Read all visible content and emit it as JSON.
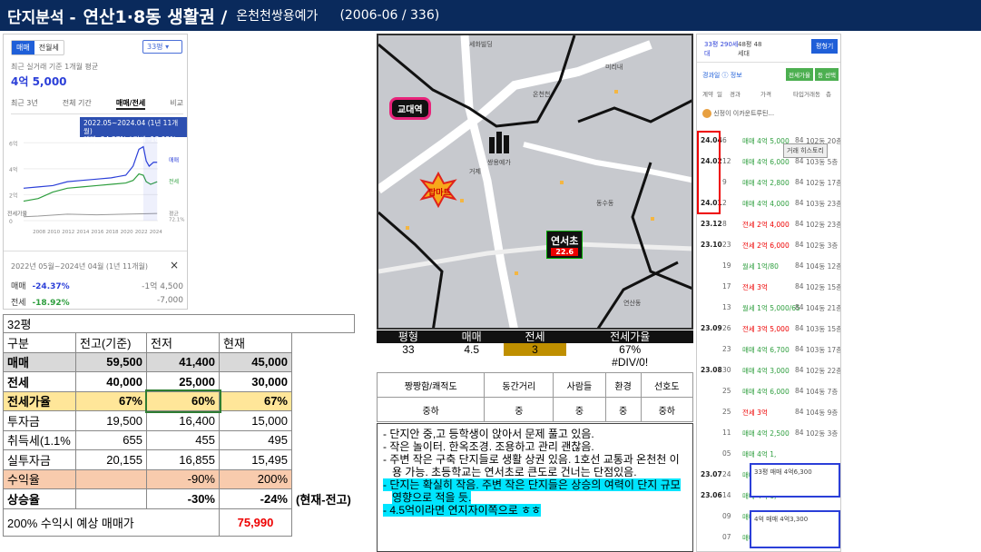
{
  "header": {
    "title_prefix": "단지분석 -",
    "title_main": "연산1·8동 생활권 /",
    "complex": "온천천쌍용예가",
    "meta": "(2006-06 / 336)"
  },
  "chart_panel": {
    "toggle": [
      "매매",
      "전월세"
    ],
    "pyeong_select": "33평 ▾",
    "avg_caption": "최근 실거래 기준 1개월 평균",
    "avg_price": "4억 5,000",
    "tabs": [
      "최근 3년",
      "전체 기간",
      "매매/전세",
      "비교"
    ],
    "tooltip": {
      "line1": "2022.05~2024.04 (1년 11개월)",
      "line2": "매매 -24.37% / 전세 -18.92%"
    },
    "y_ticks": [
      "6억",
      "4억",
      "2억",
      "0"
    ],
    "ratio_label": "전세가율",
    "ratio_value": "72.1%",
    "x_ticks": [
      "2008",
      "2010",
      "2012",
      "2014",
      "2016",
      "2018",
      "2020",
      "2022",
      "2024"
    ],
    "legend": {
      "sale": "매매",
      "jeonse": "전세",
      "avg": "평균"
    },
    "period": "2022년 05월~2024년 04월 (1년 11개월)",
    "close": "×",
    "sale_row": {
      "label": "매매",
      "pct": "-24.37%",
      "amt": "-1억 4,500"
    },
    "jeonse_row": {
      "label": "전세",
      "pct": "-18.92%",
      "amt": "-7,000"
    },
    "colors": {
      "sale": "#2b3fd8",
      "jeonse": "#2e9e3e",
      "ratio": "#999999"
    },
    "chart_data": {
      "type": "line",
      "x_range": [
        2006,
        2024.4
      ],
      "y_range": [
        0,
        7
      ],
      "series": [
        {
          "name": "매매",
          "values": [
            [
              2006,
              2.5
            ],
            [
              2008,
              2.6
            ],
            [
              2010,
              2.7
            ],
            [
              2012,
              3.0
            ],
            [
              2014,
              3.1
            ],
            [
              2016,
              3.2
            ],
            [
              2018,
              3.3
            ],
            [
              2020,
              3.5
            ],
            [
              2021,
              4.2
            ],
            [
              2021.8,
              5.5
            ],
            [
              2022.4,
              5.7
            ],
            [
              2022.8,
              4.6
            ],
            [
              2023.2,
              4.2
            ],
            [
              2023.8,
              4.5
            ],
            [
              2024.3,
              4.5
            ]
          ]
        },
        {
          "name": "전세",
          "values": [
            [
              2006,
              1.5
            ],
            [
              2008,
              1.7
            ],
            [
              2010,
              2.2
            ],
            [
              2012,
              2.5
            ],
            [
              2014,
              2.6
            ],
            [
              2016,
              2.7
            ],
            [
              2018,
              2.8
            ],
            [
              2020,
              2.9
            ],
            [
              2021,
              3.1
            ],
            [
              2021.8,
              3.6
            ],
            [
              2022.4,
              3.5
            ],
            [
              2022.8,
              3.0
            ],
            [
              2023.4,
              2.8
            ],
            [
              2024.3,
              3.0
            ]
          ]
        }
      ]
    }
  },
  "invest_table": {
    "title": "32평",
    "header": [
      "구분",
      "전고(기준)",
      "전저",
      "현재"
    ],
    "rows": [
      {
        "label": "매매",
        "v": [
          "59,500",
          "41,400",
          "45,000"
        ],
        "bold": true,
        "bg": "#d9d9d9"
      },
      {
        "label": "전세",
        "v": [
          "40,000",
          "25,000",
          "30,000"
        ],
        "bold": true,
        "bg": ""
      },
      {
        "label": "전세가율",
        "v": [
          "67%",
          "60%",
          "67%"
        ],
        "bold": true,
        "bg": "#ffe699"
      },
      {
        "label": "투자금",
        "v": [
          "19,500",
          "16,400",
          "15,000"
        ],
        "bold": false,
        "bg": ""
      },
      {
        "label": "취득세(1.1%",
        "v": [
          "655",
          "455",
          "495"
        ],
        "bold": false,
        "bg": ""
      },
      {
        "label": "실투자금",
        "v": [
          "20,155",
          "16,855",
          "15,495"
        ],
        "bold": false,
        "bg": ""
      },
      {
        "label": "수익율",
        "v": [
          "",
          "-90%",
          "200%"
        ],
        "bold": false,
        "bg": "#f8cbad"
      },
      {
        "label": "상승율",
        "v": [
          "",
          "-30%",
          "-24%"
        ],
        "bold": true,
        "bg": ""
      }
    ],
    "note": "(현재-전고)",
    "footer_label": "200% 수익시 예상 매매가",
    "footer_value": "75,990"
  },
  "map": {
    "station": "교대역",
    "mart": "탑마트",
    "school": "연서초",
    "school_pct": "22.6",
    "labels": [
      "세화빌딩",
      "온천천",
      "미리내",
      "거제",
      "쌍용예가",
      "동수동",
      "연산동"
    ]
  },
  "summary": {
    "headers": [
      "평형",
      "매매",
      "전세",
      "전세가율"
    ],
    "values": [
      "33",
      "4.5",
      "3",
      "67%"
    ],
    "error": "#DIV/0!"
  },
  "quality": {
    "headers": [
      "짱짱함/쾌적도",
      "동간거리",
      "사람들",
      "환경",
      "선호도"
    ],
    "values": [
      "중하",
      "중",
      "중",
      "중",
      "중하"
    ]
  },
  "notes": [
    {
      "text": "- 단지안 중,고 등학생이 앉아서 문제 풀고 있음.",
      "hl": false
    },
    {
      "text": "- 작은 놀이터. 한옥조경. 조용하고 관리 괜찮음.",
      "hl": false
    },
    {
      "text": "- 주변 작은 구축 단지들로 생활 상권 있음. 1호선 교통과 온천천 이용 가능. 초등학교는 연서초로 큰도로 건너는 단점있음.",
      "hl": false
    },
    {
      "text": "- 단지는 확실히 작음. 주변 작은 단지들은 상승의 여력이 단지 규모 영향으로 적을 듯.",
      "hl": true
    },
    {
      "text": "- 4.5억이라면 연지자이쪽으로 ㅎㅎ",
      "hl": true
    }
  ],
  "trades": {
    "head_left": "33평 290세대",
    "head_mid": "48평 48세대",
    "btn": "평형기",
    "sub": "경과일 ⓘ 정보",
    "btn2": "전세가율",
    "btn3": "등 선택",
    "cols": [
      "계약",
      "일",
      "경과",
      "가격",
      "타입",
      "거래동",
      "층"
    ],
    "search": "신정이 이카운트루틴...",
    "tooltip": "거래 히스토리",
    "rows": [
      {
        "ym": "24.04",
        "d": "6",
        "price": "매매 4억 5,000",
        "t": "84",
        "dong": "102동 20층",
        "red": false
      },
      {
        "ym": "24.02",
        "d": "12",
        "price": "매매 4억 6,000",
        "t": "84",
        "dong": "103동 5층",
        "red": false
      },
      {
        "ym": "",
        "d": "9",
        "price": "매매 4억 2,800",
        "t": "84",
        "dong": "102동 17층",
        "red": false
      },
      {
        "ym": "24.01",
        "d": "2",
        "price": "매매 4억 4,000",
        "t": "84",
        "dong": "103동 23층",
        "red": false
      },
      {
        "ym": "23.12",
        "d": "8",
        "price": "전세 2억 4,000",
        "t": "84",
        "dong": "102동 23층",
        "red": true
      },
      {
        "ym": "23.10",
        "d": "23",
        "price": "전세 2억 6,000",
        "t": "84",
        "dong": "102동 3층",
        "red": true
      },
      {
        "ym": "",
        "d": "19",
        "price": "월세 1억/80",
        "t": "84",
        "dong": "104동 12층",
        "red": false
      },
      {
        "ym": "",
        "d": "17",
        "price": "전세 3억",
        "t": "84",
        "dong": "102동 15층",
        "red": true
      },
      {
        "ym": "",
        "d": "13",
        "price": "월세 1억 5,000/65",
        "t": "84",
        "dong": "104동 21층",
        "red": false
      },
      {
        "ym": "23.09",
        "d": "26",
        "price": "전세 3억 5,000",
        "t": "84",
        "dong": "103동 15층",
        "red": true
      },
      {
        "ym": "",
        "d": "23",
        "price": "매매 4억 6,700",
        "t": "84",
        "dong": "103동 17층",
        "red": false
      },
      {
        "ym": "23.08",
        "d": "30",
        "price": "매매 4억 3,000",
        "t": "84",
        "dong": "102동 22층",
        "red": false
      },
      {
        "ym": "",
        "d": "25",
        "price": "매매 4억 6,000",
        "t": "84",
        "dong": "104동 7층",
        "red": false
      },
      {
        "ym": "",
        "d": "25",
        "price": "전세 3억",
        "t": "84",
        "dong": "104동 9층",
        "red": true
      },
      {
        "ym": "",
        "d": "11",
        "price": "매매 4억 2,500",
        "t": "84",
        "dong": "102동 3층",
        "red": false
      },
      {
        "ym": "",
        "d": "05",
        "price": "매매 4억 1,",
        "t": "",
        "dong": "",
        "red": false
      },
      {
        "ym": "23.07",
        "d": "24",
        "price": "매매 4억 6,",
        "t": "",
        "dong": "",
        "red": false
      },
      {
        "ym": "23.06",
        "d": "14",
        "price": "매매 4억 6,",
        "t": "",
        "dong": "",
        "red": false
      },
      {
        "ym": "",
        "d": "09",
        "price": "매매 5억",
        "t": "",
        "dong": "",
        "red": false
      },
      {
        "ym": "",
        "d": "07",
        "price": "매매 2억 5,",
        "t": "",
        "dong": "",
        "red": false
      }
    ],
    "popup1": {
      "a": "33평",
      "b": "매매",
      "c": "4억6,300"
    },
    "popup2": {
      "a": "4억",
      "b": "매매",
      "c": "4억3,300"
    }
  }
}
